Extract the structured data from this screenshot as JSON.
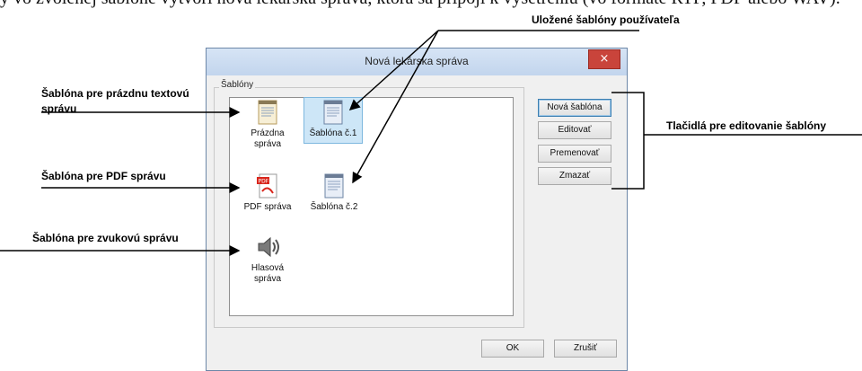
{
  "top_text": "y vo zvolenej šablóne vytvorí nová lekárska správa, ktorá sa pripojí k vyšetreniu (vo formáte RTF, PDF alebo WAV).",
  "dialog": {
    "title": "Nová lekárska správa",
    "close_glyph": "×",
    "group_label": "Šablóny",
    "items": [
      {
        "label": "Prázdna správa",
        "icon": "document-icon"
      },
      {
        "label": "Šablóna č.1",
        "icon": "document-icon"
      },
      {
        "label": "PDF správa",
        "icon": "pdf-icon"
      },
      {
        "label": "Šablóna č.2",
        "icon": "document-icon"
      },
      {
        "label": "Hlasová správa",
        "icon": "speaker-icon"
      }
    ],
    "buttons": {
      "new": "Nová šablóna",
      "edit": "Editovať",
      "rename": "Premenovať",
      "delete": "Zmazať",
      "ok": "OK",
      "cancel": "Zrušiť"
    }
  },
  "annotations": {
    "user_saved": "Uložené šablóny používateľa",
    "empty_text": "Šablóna pre prázdnu textovú správu",
    "pdf": "Šablóna pre PDF správu",
    "audio": "Šablóna pre zvukovú správu",
    "edit_buttons": "Tlačidlá pre editovanie šablóny"
  },
  "colors": {
    "titlebar": "#c9dbf0",
    "close": "#c9443b",
    "selection": "#cde6f7"
  }
}
